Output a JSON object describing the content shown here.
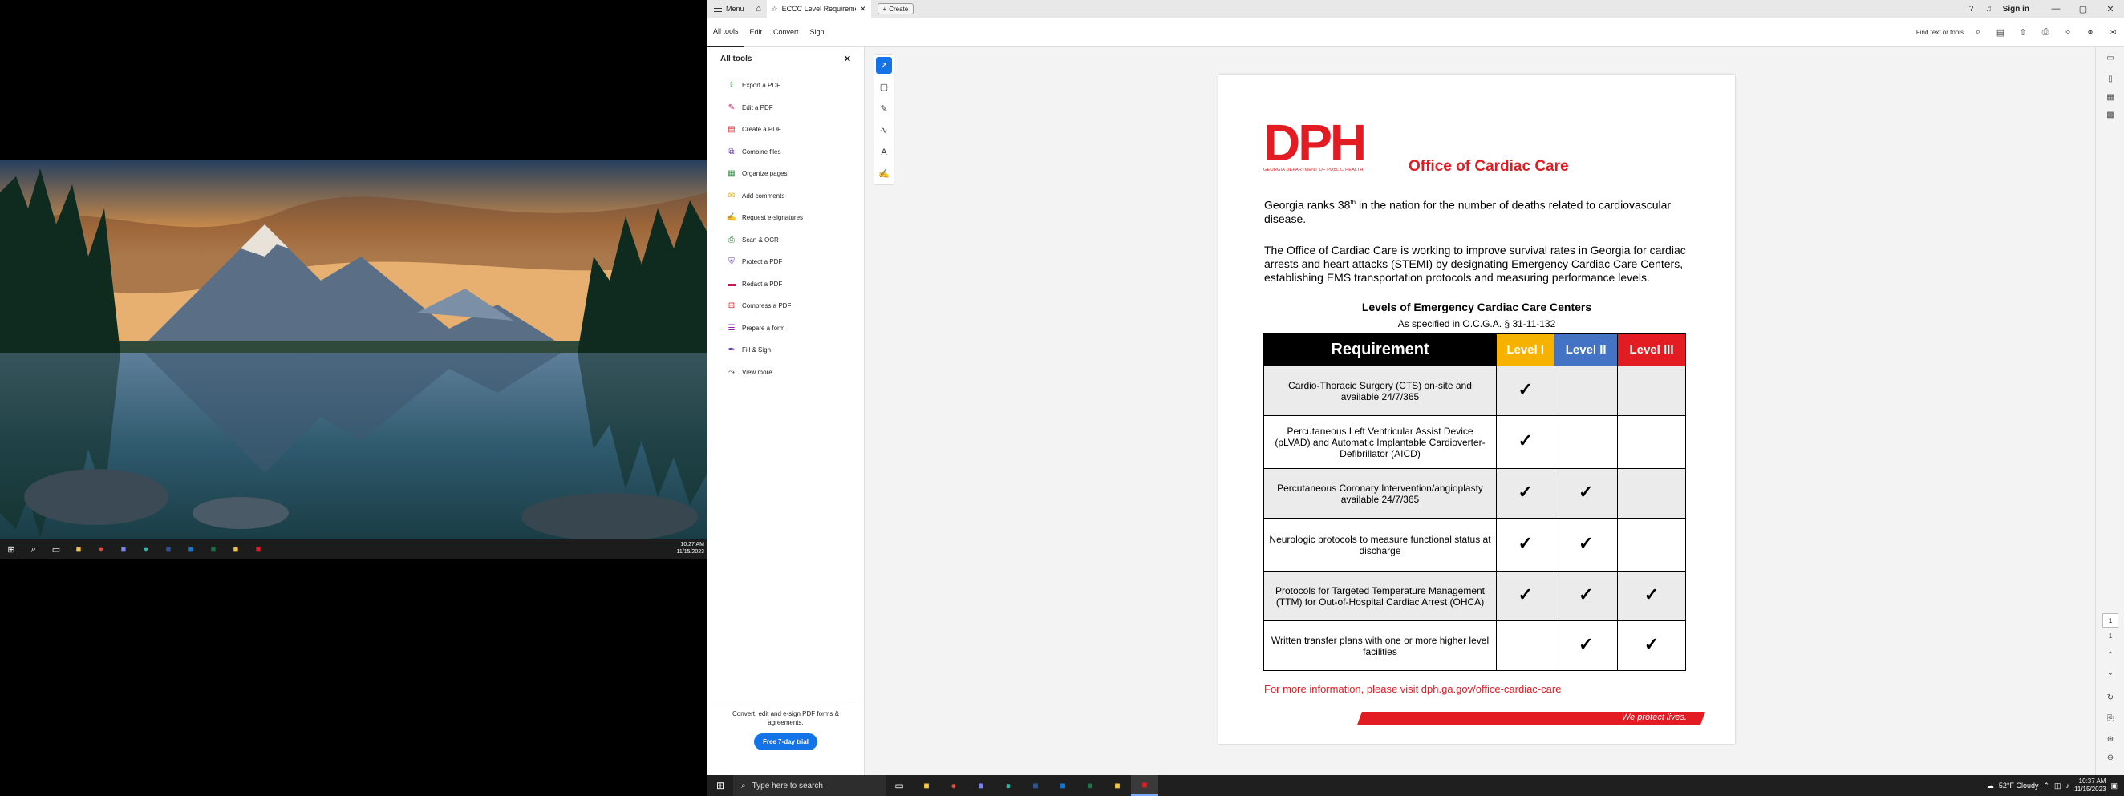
{
  "left_taskbar": {
    "time": "10:27 AM",
    "date": "11/15/2023"
  },
  "titlebar": {
    "menu_label": "Menu",
    "tab_title": "ECCC Level Requireme...",
    "create_label": "Create",
    "sign_in": "Sign in"
  },
  "menubar": {
    "items": [
      "All tools",
      "Edit",
      "Convert",
      "Sign"
    ],
    "find_text": "Find text or tools"
  },
  "tools_panel": {
    "title": "All tools",
    "items": [
      {
        "label": "Export a PDF",
        "icon": "export-pdf-icon",
        "color": "#2b8a3e"
      },
      {
        "label": "Edit a PDF",
        "icon": "edit-pdf-icon",
        "color": "#c2185b"
      },
      {
        "label": "Create a PDF",
        "icon": "create-pdf-icon",
        "color": "#e31b23"
      },
      {
        "label": "Combine files",
        "icon": "combine-files-icon",
        "color": "#5e35b1"
      },
      {
        "label": "Organize pages",
        "icon": "organize-pages-icon",
        "color": "#2b8a3e"
      },
      {
        "label": "Add comments",
        "icon": "add-comments-icon",
        "color": "#e0a800"
      },
      {
        "label": "Request e-signatures",
        "icon": "request-esign-icon",
        "color": "#8e24aa"
      },
      {
        "label": "Scan & OCR",
        "icon": "scan-ocr-icon",
        "color": "#2b8a3e"
      },
      {
        "label": "Protect a PDF",
        "icon": "protect-pdf-icon",
        "color": "#5e35b1"
      },
      {
        "label": "Redact a PDF",
        "icon": "redact-pdf-icon",
        "color": "#c2185b"
      },
      {
        "label": "Compress a PDF",
        "icon": "compress-pdf-icon",
        "color": "#e31b23"
      },
      {
        "label": "Prepare a form",
        "icon": "prepare-form-icon",
        "color": "#8e24aa"
      },
      {
        "label": "Fill & Sign",
        "icon": "fill-sign-icon",
        "color": "#5e35b1"
      },
      {
        "label": "View more",
        "icon": "view-more-icon",
        "color": "#333333"
      }
    ],
    "footer_text": "Convert, edit and e-sign PDF forms & agreements.",
    "trial_button": "Free 7-day trial"
  },
  "right_rail": {
    "page_current": "1",
    "page_total": "1"
  },
  "pdf": {
    "logo_letters": "DPH",
    "logo_sub": "GEORGIA DEPARTMENT OF PUBLIC HEALTH",
    "office_title": "Office of Cardiac Care",
    "para1_a": "Georgia ranks 38",
    "para1_sup": "th",
    "para1_b": " in the nation for the number of deaths related to cardiovascular disease.",
    "para2": "The Office of Cardiac Care is working to improve survival rates in Georgia for cardiac arrests and heart attacks (STEMI) by designating Emergency Cardiac Care Centers, establishing EMS transportation protocols and measuring performance levels.",
    "levels_title": "Levels of Emergency Cardiac Care Centers",
    "levels_sub": "As specified in O.C.G.A. § 31-11-132",
    "table_headers": [
      "Requirement",
      "Level I",
      "Level II",
      "Level III"
    ],
    "header_colors": {
      "level1": "#f7b200",
      "level2": "#4472c4",
      "level3": "#e31b23"
    },
    "rows": [
      {
        "req": "Cardio-Thoracic Surgery (CTS) on-site and available 24/7/365",
        "l1": "✓",
        "l2": "",
        "l3": ""
      },
      {
        "req": "Percutaneous Left Ventricular Assist Device (pLVAD) and Automatic Implantable Cardioverter-Defibrillator (AICD)",
        "l1": "✓",
        "l2": "",
        "l3": ""
      },
      {
        "req": "Percutaneous Coronary Intervention/angioplasty available 24/7/365",
        "l1": "✓",
        "l2": "✓",
        "l3": ""
      },
      {
        "req": "Neurologic protocols to measure functional status at discharge",
        "l1": "✓",
        "l2": "✓",
        "l3": ""
      },
      {
        "req": "Protocols for Targeted Temperature Management (TTM) for Out-of-Hospital Cardiac Arrest (OHCA)",
        "l1": "✓",
        "l2": "✓",
        "l3": "✓"
      },
      {
        "req": "Written transfer plans with one or more higher level facilities",
        "l1": "",
        "l2": "✓",
        "l3": "✓"
      }
    ],
    "more_info": "For more information, please visit dph.ga.gov/office-cardiac-care",
    "slogan": "We protect lives."
  },
  "taskbar": {
    "search_placeholder": "Type here to search",
    "weather": "52°F Cloudy",
    "time": "10:37 AM",
    "date": "11/15/2023"
  }
}
